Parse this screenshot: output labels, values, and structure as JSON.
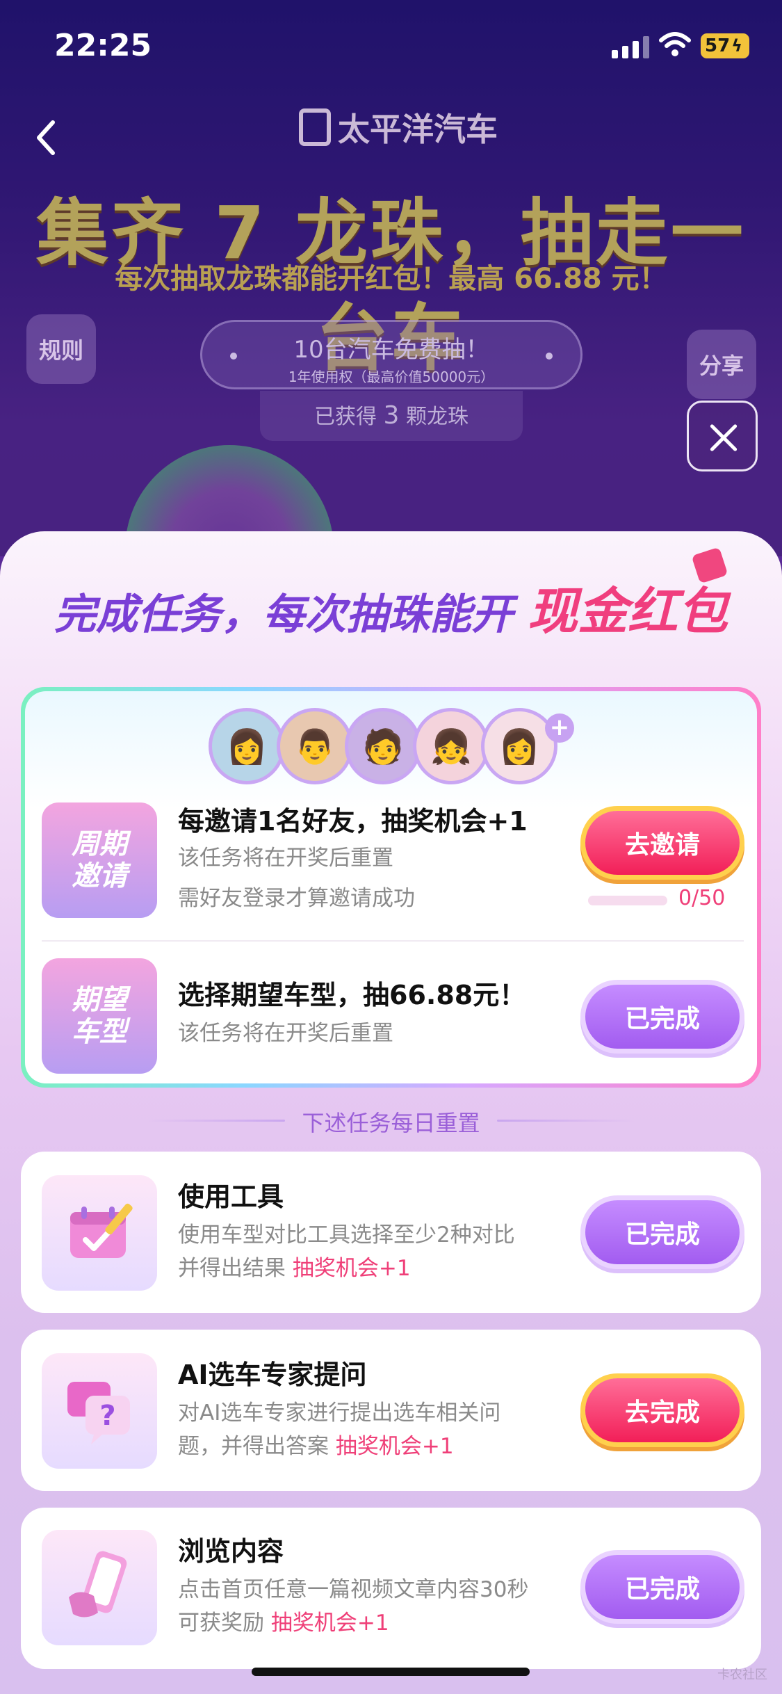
{
  "status_bar": {
    "time": "22:25",
    "battery": "57"
  },
  "header": {
    "logo_text": "太平洋汽车",
    "headline": "集齐 7 龙珠，抽走一台车",
    "subline": "每次抽取龙珠都能开红包！最高 66.88 元！",
    "rules_label": "规则",
    "share_label": "分享",
    "prize_title": "10台汽车免费抽！",
    "prize_sub": "1年使用权（最高价值50000元）",
    "pearls_prefix": "已获得",
    "pearls_count": "3",
    "pearls_suffix": "颗龙珠"
  },
  "sheet": {
    "title_main": "完成任务，每次抽珠能开",
    "title_highlight": "现金红包",
    "weekly_tasks": [
      {
        "badge": "周期邀请",
        "badge_line1": "周期",
        "badge_line2": "邀请",
        "title": "每邀请1名好友，抽奖机会+1",
        "desc1": "该任务将在开奖后重置",
        "desc2": "需好友登录才算邀请成功",
        "button": "去邀请",
        "progress": "0/50",
        "progress_fraction": 0
      },
      {
        "badge": "期望车型",
        "badge_line1": "期望",
        "badge_line2": "车型",
        "title": "选择期望车型，抽66.88元！",
        "desc1": "该任务将在开奖后重置",
        "button": "已完成"
      }
    ],
    "daily_label": "下述任务每日重置",
    "daily_tasks": [
      {
        "icon": "calendar-pencil-icon",
        "title": "使用工具",
        "desc_line1": "使用车型对比工具选择至少2种对比",
        "desc_line2": "并得出结果",
        "reward": "抽奖机会+1",
        "button": "已完成"
      },
      {
        "icon": "question-chat-icon",
        "title": "AI选车专家提问",
        "desc_line1": "对AI选车专家进行提出选车相关问",
        "desc_line2": "题，并得出答案",
        "reward": "抽奖机会+1",
        "button": "去完成"
      },
      {
        "icon": "phone-hand-icon",
        "title": "浏览内容",
        "desc_line1": "点击首页任意一篇视频文章内容30秒",
        "desc_line2": "可获奖励",
        "reward": "抽奖机会+1",
        "button": "已完成"
      }
    ]
  },
  "watermark": "卡农社区",
  "colors": {
    "accent_pink": "#f21f58",
    "accent_purple": "#a25cf0",
    "highlight": "#ef3f78",
    "gold": "#ffd04d"
  }
}
